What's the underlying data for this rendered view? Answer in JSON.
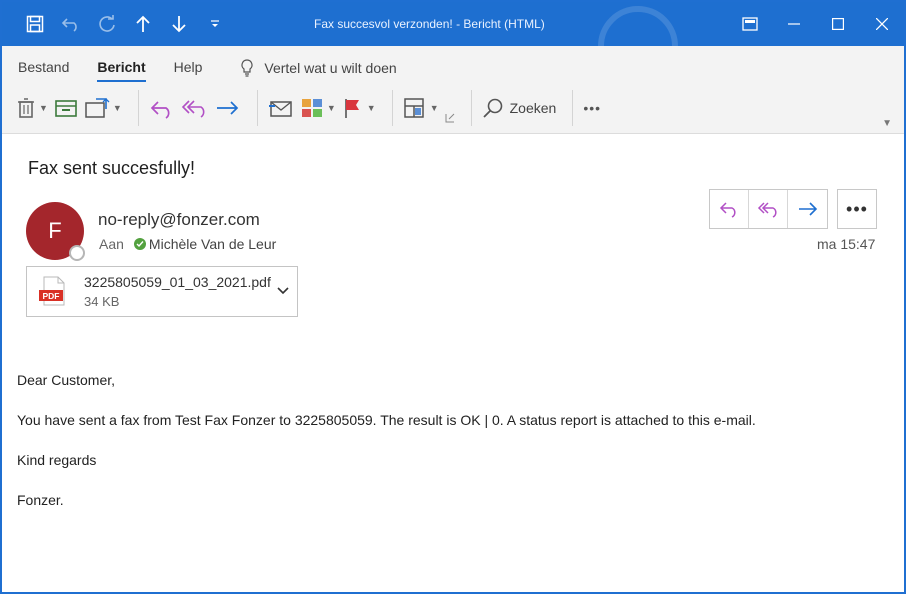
{
  "window": {
    "title": "Fax succesvol verzonden!  -  Bericht (HTML)",
    "accent": "#1e6fd0"
  },
  "quick_access": {
    "icons": [
      "save-icon",
      "undo-icon",
      "redo-icon",
      "arrow-up-icon",
      "arrow-down-icon",
      "customize-icon"
    ]
  },
  "ribbon": {
    "tabs": [
      "Bestand",
      "Bericht",
      "Help"
    ],
    "active_tab": "Bericht",
    "tell_me": "Vertel wat u wilt doen",
    "search_label": "Zoeken",
    "more_label": "•••"
  },
  "message": {
    "subject": "Fax sent succesfully!",
    "avatar_initial": "F",
    "avatar_color": "#a4262c",
    "sender": "no-reply@fonzer.com",
    "to_label": "Aan",
    "recipient": "Michèle Van de Leur",
    "timestamp": "ma 15:47",
    "more_label": "•••"
  },
  "attachment": {
    "type_label": "PDF",
    "filename": "3225805059_01_03_2021.pdf",
    "size": "34 KB"
  },
  "body": {
    "lines": [
      "Dear Customer,",
      "You have sent a fax from Test Fax Fonzer to 3225805059. The result is OK | 0. A status report is attached to this e-mail.",
      "Kind regards",
      "Fonzer."
    ]
  }
}
